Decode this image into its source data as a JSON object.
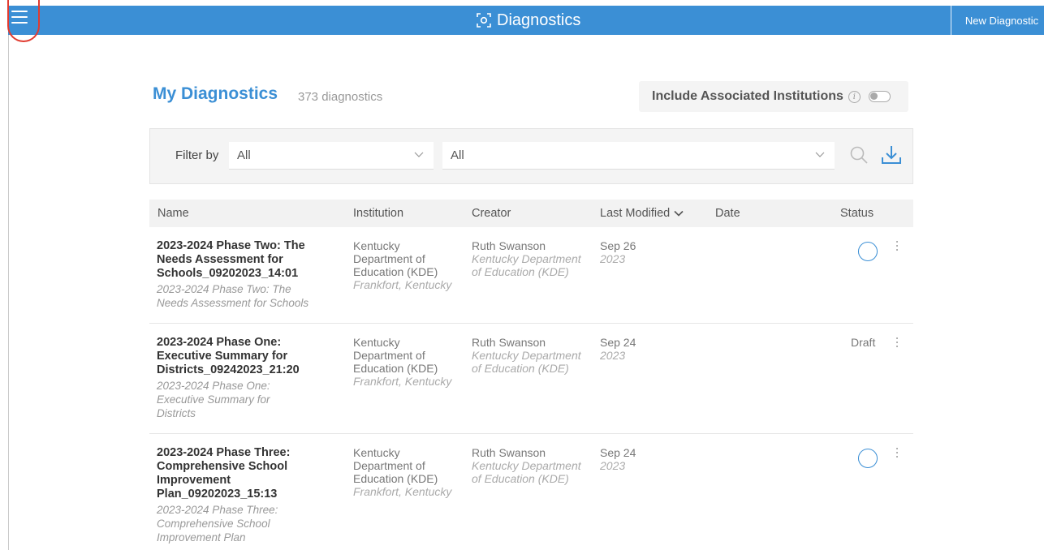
{
  "header": {
    "app_title": "Diagnostics",
    "app_icon": "diagnostics-focus-icon",
    "new_button_label": "New Diagnostic",
    "colors": {
      "brand": "#3b8fd5",
      "highlight_ring": "#e13b30"
    }
  },
  "page": {
    "title": "My Diagnostics",
    "count_text": "373 diagnostics",
    "include_associated_label": "Include Associated Institutions",
    "include_associated_enabled": false
  },
  "filters": {
    "label": "Filter by",
    "filter1_value": "All",
    "filter2_value": "All"
  },
  "table": {
    "columns": {
      "name": "Name",
      "institution": "Institution",
      "creator": "Creator",
      "last_modified": "Last Modified",
      "date": "Date",
      "status": "Status"
    },
    "rows": [
      {
        "title_lines": [
          "2023-2024 Phase Two: The",
          "Needs Assessment for",
          "Schools_09202023_14:01"
        ],
        "subtitle_lines": [
          "2023-2024 Phase Two: The",
          "Needs Assessment for Schools"
        ],
        "institution_lines": [
          "Kentucky",
          "Department of",
          "Education (KDE)"
        ],
        "institution_location": "Frankfort, Kentucky",
        "creator": "Ruth Swanson",
        "creator_org_lines": [
          "Kentucky Department",
          "of Education (KDE)"
        ],
        "modified_date": "Sep 26",
        "modified_year": "2023",
        "status": "",
        "status_icon": "circle-status-icon"
      },
      {
        "title_lines": [
          "2023-2024 Phase One:",
          "Executive Summary for",
          "Districts_09242023_21:20"
        ],
        "subtitle_lines": [
          "2023-2024 Phase One:",
          "Executive Summary for",
          "Districts"
        ],
        "institution_lines": [
          "Kentucky",
          "Department of",
          "Education (KDE)"
        ],
        "institution_location": "Frankfort, Kentucky",
        "creator": "Ruth Swanson",
        "creator_org_lines": [
          "Kentucky Department",
          "of Education (KDE)"
        ],
        "modified_date": "Sep 24",
        "modified_year": "2023",
        "status": "Draft"
      },
      {
        "title_lines": [
          "2023-2024 Phase Three:",
          "Comprehensive School",
          "Improvement",
          "Plan_09202023_15:13"
        ],
        "subtitle_lines": [
          "2023-2024 Phase Three:",
          "Comprehensive School",
          "Improvement Plan"
        ],
        "institution_lines": [
          "Kentucky",
          "Department of",
          "Education (KDE)"
        ],
        "institution_location": "Frankfort, Kentucky",
        "creator": "Ruth Swanson",
        "creator_org_lines": [
          "Kentucky Department",
          "of Education (KDE)"
        ],
        "modified_date": "Sep 24",
        "modified_year": "2023",
        "status": "",
        "status_icon": "circle-status-icon"
      }
    ]
  }
}
